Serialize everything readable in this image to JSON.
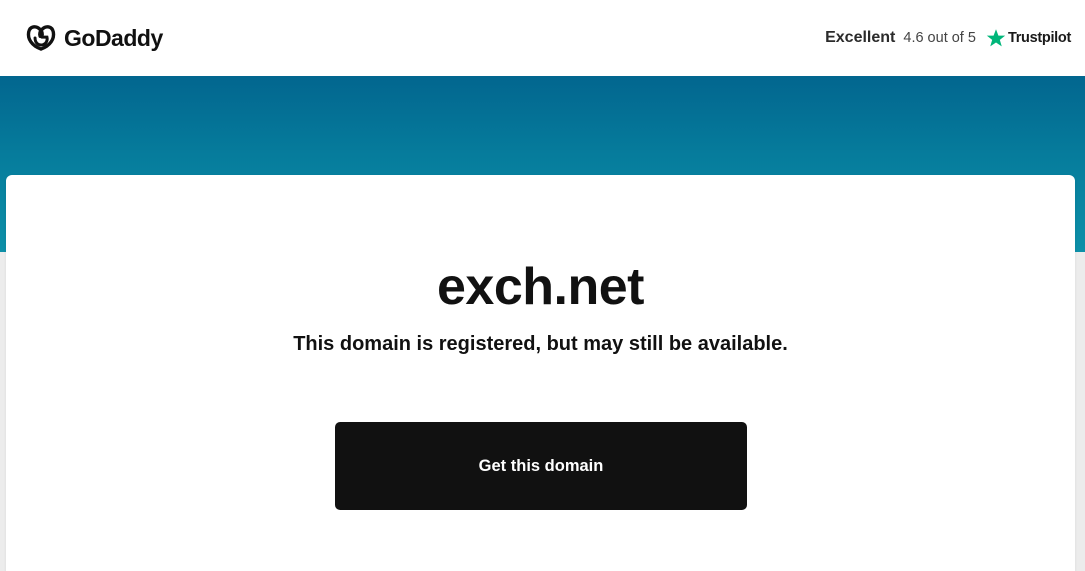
{
  "header": {
    "brand": "GoDaddy",
    "logo_icon": "godaddy-logo-icon",
    "rating": {
      "label": "Excellent",
      "score_text": "4.6 out of 5",
      "provider": "Trustpilot",
      "provider_icon": "trustpilot-star-icon",
      "star_color": "#00b67a"
    }
  },
  "hero": {
    "band_color": "#067c9c"
  },
  "main": {
    "domain": "exch.net",
    "tagline": "This domain is registered, but may still be available.",
    "cta_label": "Get this domain"
  }
}
